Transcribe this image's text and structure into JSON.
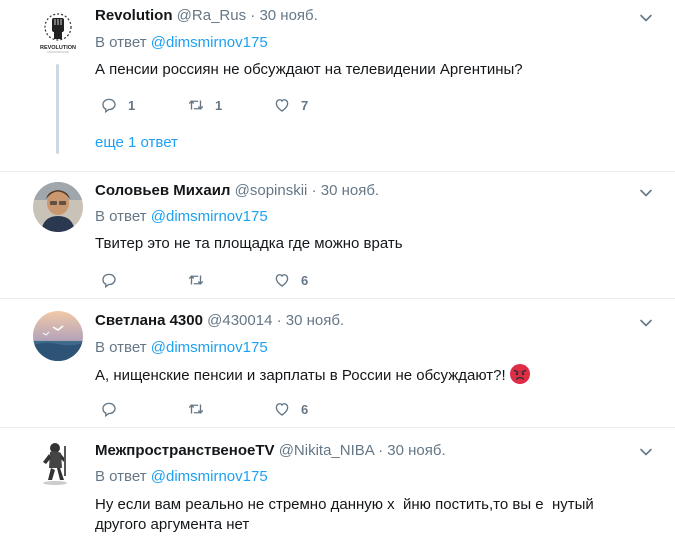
{
  "tweets": [
    {
      "name": "Revolution",
      "handle": "@Ra_Rus",
      "dot": "·",
      "time": "30 нояб.",
      "reply_prefix": "В ответ",
      "reply_to": "@dimsmirnov175",
      "text": "А пенсии россиян не обсуждают на телевидении Аргентины?",
      "replies": "1",
      "retweets": "1",
      "likes": "7",
      "more": "еще 1 ответ",
      "avatar_text": "REVOLUTION"
    },
    {
      "name": "Соловьев Михаил",
      "handle": "@sopinskii",
      "dot": "·",
      "time": "30 нояб.",
      "reply_prefix": "В ответ",
      "reply_to": "@dimsmirnov175",
      "text": "Твитер это не та площадка где можно врать",
      "replies": "",
      "retweets": "",
      "likes": "6"
    },
    {
      "name": "Светлана 4300",
      "handle": "@430014",
      "dot": "·",
      "time": "30 нояб.",
      "reply_prefix": "В ответ",
      "reply_to": "@dimsmirnov175",
      "text": "А, нищенские пенсии и зарплаты в России не обсуждают?!",
      "replies": "",
      "retweets": "",
      "likes": "6"
    },
    {
      "name": "МежпространственоеTV",
      "handle": "@Nikita_NIBA",
      "dot": "·",
      "time": "30 нояб.",
      "reply_prefix": "В ответ",
      "reply_to": "@dimsmirnov175",
      "text_line1": "Ну если вам реально не стремно данную х  йню постить,то вы е  нутый",
      "text_line2": "другого аргумента нет"
    }
  ],
  "colors": {
    "link": "#1da1f2",
    "secondary": "#657786",
    "divider": "#e6ecf0",
    "angry_emoji": "#e0245e"
  },
  "icons": [
    "reply-icon",
    "retweet-icon",
    "like-icon",
    "chevron-down-icon",
    "angry-face-icon"
  ]
}
